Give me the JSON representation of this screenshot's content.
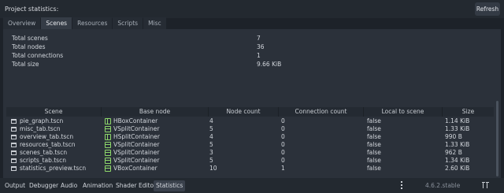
{
  "header": {
    "title": "Project statistics:",
    "refresh_label": "Refresh"
  },
  "tabs": [
    {
      "label": "Overview",
      "active": false
    },
    {
      "label": "Scenes",
      "active": true
    },
    {
      "label": "Resources",
      "active": false
    },
    {
      "label": "Scripts",
      "active": false
    },
    {
      "label": "Misc",
      "active": false
    }
  ],
  "stats": [
    {
      "label": "Total scenes",
      "value": "7"
    },
    {
      "label": "Total nodes",
      "value": "36"
    },
    {
      "label": "Total connections",
      "value": "1"
    },
    {
      "label": "Total size",
      "value": "9.66 KiB"
    }
  ],
  "table": {
    "columns": [
      "Scene",
      "Base node",
      "Node count",
      "Connection count",
      "Local to scene",
      "Size"
    ],
    "rows": [
      {
        "scene": "pie_graph.tscn",
        "base_node": "HBoxContainer",
        "icon": "hbox-icon",
        "node_count": "4",
        "connection_count": "0",
        "local": "false",
        "size": "1.14 KiB"
      },
      {
        "scene": "misc_tab.tscn",
        "base_node": "VSplitContainer",
        "icon": "vsplit-icon",
        "node_count": "5",
        "connection_count": "0",
        "local": "false",
        "size": "1.33 KiB"
      },
      {
        "scene": "overview_tab.tscn",
        "base_node": "HSplitContainer",
        "icon": "hsplit-icon",
        "node_count": "4",
        "connection_count": "0",
        "local": "false",
        "size": "990 B"
      },
      {
        "scene": "resources_tab.tscn",
        "base_node": "VSplitContainer",
        "icon": "vsplit-icon",
        "node_count": "5",
        "connection_count": "0",
        "local": "false",
        "size": "1.33 KiB"
      },
      {
        "scene": "scenes_tab.tscn",
        "base_node": "VSplitContainer",
        "icon": "vsplit-icon",
        "node_count": "3",
        "connection_count": "0",
        "local": "false",
        "size": "962 B"
      },
      {
        "scene": "scripts_tab.tscn",
        "base_node": "VSplitContainer",
        "icon": "vsplit-icon",
        "node_count": "5",
        "connection_count": "0",
        "local": "false",
        "size": "1.34 KiB"
      },
      {
        "scene": "statistics_preview.tscn",
        "base_node": "VBoxContainer",
        "icon": "vbox-icon",
        "node_count": "10",
        "connection_count": "1",
        "local": "false",
        "size": "2.60 KiB"
      }
    ]
  },
  "bottom_tabs": [
    {
      "label": "Output",
      "active": false
    },
    {
      "label": "Debugger",
      "active": false
    },
    {
      "label": "Audio",
      "active": false
    },
    {
      "label": "Animation",
      "active": false
    },
    {
      "label": "Shader Editor",
      "active": false
    },
    {
      "label": "Statistics",
      "active": true
    }
  ],
  "version": "4.6.2.stable",
  "colors": {
    "background": "#1d2229",
    "panel": "#2b313a",
    "node_icon": "#8ed86a"
  }
}
